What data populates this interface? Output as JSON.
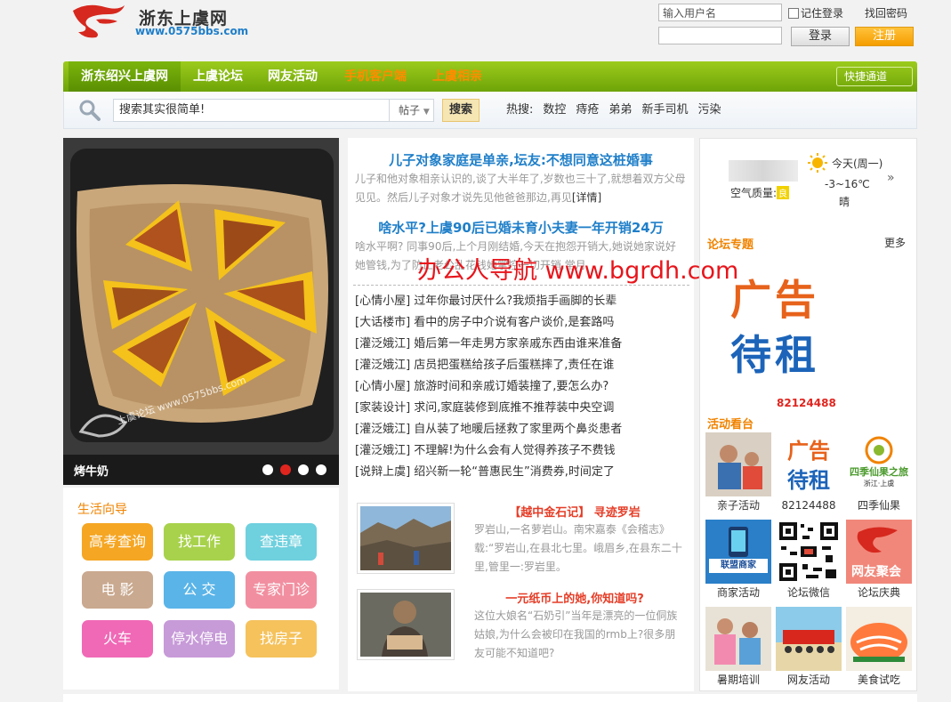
{
  "header": {
    "logo_name": "浙东上虞网",
    "logo_url": "www.0575bbs.com",
    "login": {
      "username_placeholder": "输入用户名",
      "remember_label": "记住登录",
      "find_password": "找回密码",
      "login_button": "登录",
      "register_button": "注册"
    }
  },
  "nav": {
    "items": [
      "浙东绍兴上虞网",
      "上虞论坛",
      "网友活动",
      "手机客户端",
      "上虞相亲"
    ],
    "quick_access": "快捷通道"
  },
  "search": {
    "placeholder": "搜索其实很简单!",
    "type": "帖子",
    "button": "搜索",
    "hot_label": "热搜:",
    "hot_terms": [
      "数控",
      "痔疮",
      "弟弟",
      "新手司机",
      "污染"
    ]
  },
  "slider": {
    "title": "烤牛奶",
    "image_watermark": "上虞论坛 www.0575bbs.com",
    "total_slides": 4,
    "active_slide": 2
  },
  "life_guide": {
    "title": "生活向导",
    "buttons": [
      {
        "label": "高考查询",
        "color": "#f5a623"
      },
      {
        "label": "找工作",
        "color": "#a8d24c"
      },
      {
        "label": "查违章",
        "color": "#6fd0de"
      },
      {
        "label": "电 影",
        "color": "#c9a98f"
      },
      {
        "label": "公 交",
        "color": "#5ab4e8"
      },
      {
        "label": "专家门诊",
        "color": "#f18fa0"
      },
      {
        "label": "火车",
        "color": "#f069b6"
      },
      {
        "label": "停水停电",
        "color": "#c79ad8"
      },
      {
        "label": "找房子",
        "color": "#f5c25c"
      }
    ]
  },
  "headlines": [
    {
      "title": "儿子对象家庭是单亲,坛友:不想同意这桩婚事",
      "desc": "儿子和他对象相亲认识的,谈了大半年了,岁数也三十了,就想着双方父母见见。然后儿子对象才说先见他爸爸那边,再见",
      "link": "[详情]"
    },
    {
      "title": "啥水平?上虞90后已婚未育小夫妻一年开销24万",
      "desc": "啥水平啊? 同事90后,上个月刚结婚,今天在抱怨开销大,她说她家说好她管钱,为了防止老公乱花钱她掌控一切开销,常月"
    }
  ],
  "news_list": [
    {
      "cat": "[心情小屋]",
      "title": "过年你最讨厌什么?我烦指手画脚的长辈"
    },
    {
      "cat": "[大话楼市]",
      "title": "看中的房子中介说有客户谈价,是套路吗"
    },
    {
      "cat": "[灌泛娥江]",
      "title": "婚后第一年走男方家亲戚东西由谁来准备"
    },
    {
      "cat": "[灌泛娥江]",
      "title": "店员把蛋糕给孩子后蛋糕摔了,责任在谁"
    },
    {
      "cat": "[心情小屋]",
      "title": "旅游时间和亲戚订婚装撞了,要怎么办?"
    },
    {
      "cat": "[家装设计]",
      "title": "求问,家庭装修到底推不推荐装中央空调"
    },
    {
      "cat": "[灌泛娥江]",
      "title": "自从装了地暖后拯救了家里两个鼻炎患者"
    },
    {
      "cat": "[灌泛娥江]",
      "title": "不理解!为什么会有人觉得养孩子不费钱"
    },
    {
      "cat": "[说辩上虞]",
      "title": "绍兴新一轮“普惠民生”消费券,时间定了"
    }
  ],
  "features": [
    {
      "title": "【越中金石记】 寻迹罗岩",
      "desc": "罗岩山,一名萝岩山。南宋嘉泰《会稽志》载:“罗岩山,在县北七里。峨眉乡,在县东二十里,管里一:罗岩里。"
    },
    {
      "title": "一元纸币上的她,你知道吗?",
      "desc": "这位大娘名“石奶引”当年是漂亮的一位侗族姑娘,为什么会被印在我国的rmb上?很多朋友可能不知道吧?"
    }
  ],
  "weather": {
    "today": "今天(周一)",
    "temp": "-3~16℃",
    "sky": "晴",
    "aqi_label": "空气质量:",
    "aqi_value": "良"
  },
  "forum_topics": {
    "title": "论坛专题",
    "more": "更多",
    "ad_line1": "广告",
    "ad_line2": "待租",
    "phone": "82124488"
  },
  "activities": {
    "title": "活动看台",
    "items": [
      {
        "caption": "亲子活动"
      },
      {
        "caption": "82124488",
        "ad_line1": "广告",
        "ad_line2": "待租"
      },
      {
        "caption": "四季仙果",
        "logo_text": "四季仙果之旅",
        "logo_sub": "浙江·上虞"
      },
      {
        "caption": "商家活动",
        "poster_text": "联盟商家"
      },
      {
        "caption": "论坛微信"
      },
      {
        "caption": "论坛庆典",
        "badge_text": "网友聚会"
      },
      {
        "caption": "暑期培训"
      },
      {
        "caption": "网友活动"
      },
      {
        "caption": "美食试吃"
      }
    ]
  },
  "overlay_watermark": "办公人导航 www.bgrdh.com"
}
